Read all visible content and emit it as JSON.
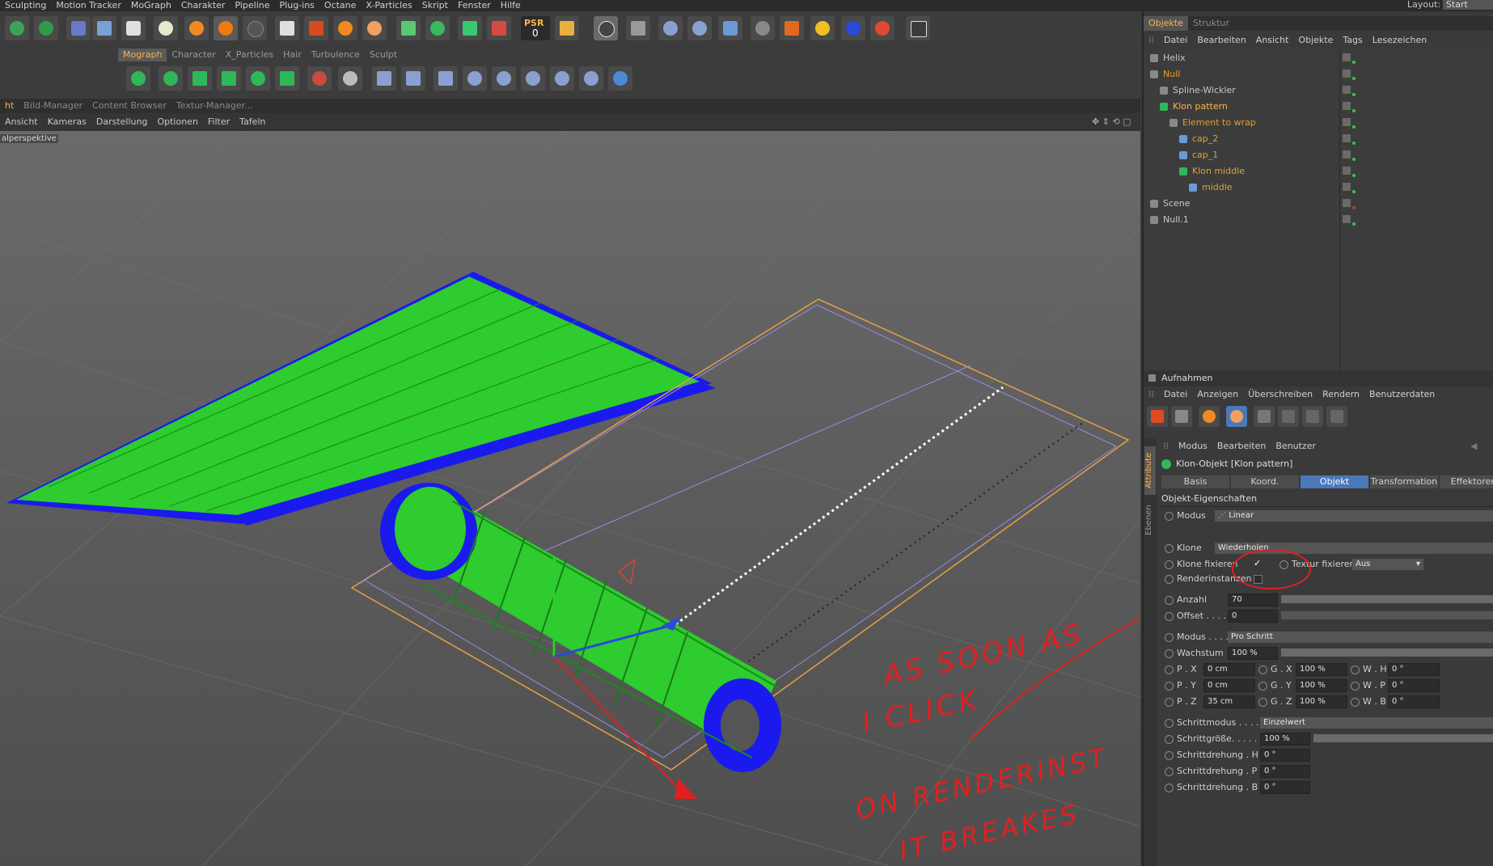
{
  "menubar": [
    "Sculpting",
    "Motion Tracker",
    "MoGraph",
    "Charakter",
    "Pipeline",
    "Plug-ins",
    "Octane",
    "X-Particles",
    "Skript",
    "Fenster",
    "Hilfe"
  ],
  "layout": {
    "label": "Layout:",
    "value": "Start (Benu"
  },
  "toolbar1": {
    "psr_label": "PSR",
    "psr_value": "0"
  },
  "subtabs": [
    "Mograph",
    "Character",
    "X_Particles",
    "Hair",
    "Turbulence",
    "Sculpt"
  ],
  "viewport_tabs": [
    "ht",
    "Bild-Manager",
    "Content Browser",
    "Textur-Manager..."
  ],
  "viewport_menu": [
    "Ansicht",
    "Kameras",
    "Darstellung",
    "Optionen",
    "Filter",
    "Tafeln"
  ],
  "viewport_label": "alperspektive",
  "objects_panel": {
    "tabs": [
      "Objekte",
      "Struktur"
    ],
    "menu": [
      "Datei",
      "Bearbeiten",
      "Ansicht",
      "Objekte",
      "Tags",
      "Lesezeichen"
    ],
    "items": [
      {
        "name": "Helix",
        "indent": 0,
        "color": "#c8c8c8"
      },
      {
        "name": "Null",
        "indent": 0,
        "color": "#e0a030"
      },
      {
        "name": "Spline-Wickler",
        "indent": 1,
        "color": "#c8c8c8"
      },
      {
        "name": "Klon pattern",
        "indent": 1,
        "color": "#ffb347"
      },
      {
        "name": "Element to wrap",
        "indent": 2,
        "color": "#e0a030"
      },
      {
        "name": "cap_2",
        "indent": 3,
        "color": "#e0a030"
      },
      {
        "name": "cap_1",
        "indent": 3,
        "color": "#e0a030"
      },
      {
        "name": "Klon middle",
        "indent": 3,
        "color": "#e0a030"
      },
      {
        "name": "middle",
        "indent": 4,
        "color": "#e0a030"
      },
      {
        "name": "Scene",
        "indent": 0,
        "color": "#c8c8c8"
      },
      {
        "name": "Null.1",
        "indent": 0,
        "color": "#c8c8c8"
      }
    ]
  },
  "takes_panel": {
    "title": "Aufnahmen",
    "menu": [
      "Datei",
      "Anzeigen",
      "Überschreiben",
      "Rendern",
      "Benutzerdaten"
    ]
  },
  "attributes": {
    "side_tabs": [
      "Attribute",
      "Ebenen"
    ],
    "menu": [
      "Modus",
      "Bearbeiten",
      "Benutzer"
    ],
    "object_title": "Klon-Objekt [Klon pattern]",
    "tabs": [
      "Basis",
      "Koord.",
      "Objekt",
      "Transformation",
      "Effektoren"
    ],
    "section": "Objekt-Eigenschaften",
    "modus_label": "Modus",
    "modus_value": "Linear",
    "klone_label": "Klone",
    "klone_value": "Wiederholen",
    "klone_fixieren_label": "Klone fixieren",
    "textur_fixieren_label": "Textur fixieren",
    "textur_fixieren_value": "Aus",
    "renderinstanzen_label": "Renderinstanzen",
    "anzahl_label": "Anzahl",
    "anzahl_value": "70",
    "offset_label": "Offset . . . .",
    "offset_value": "0",
    "modus2_label": "Modus . . . .",
    "modus2_value": "Pro Schritt",
    "wachstum_label": "Wachstum",
    "wachstum_value": "100 %",
    "px_label": "P . X",
    "px_value": "0 cm",
    "py_label": "P . Y",
    "py_value": "0 cm",
    "pz_label": "P . Z",
    "pz_value": "35 cm",
    "gx_label": "G . X",
    "gx_value": "100 %",
    "gy_label": "G . Y",
    "gy_value": "100 %",
    "gz_label": "G . Z",
    "gz_value": "100 %",
    "wh_label": "W . H",
    "wh_value": "0 °",
    "wp_label": "W . P",
    "wp_value": "0 °",
    "wb_label": "W . B",
    "wb_value": "0 °",
    "schrittmodus_label": "Schrittmodus . . . . .",
    "schrittmodus_value": "Einzelwert",
    "schrittgroesse_label": "Schrittgröße. . . . .",
    "schrittgroesse_value": "100 %",
    "sdh_label": "Schrittdrehung . H",
    "sdh_value": "0 °",
    "sdp_label": "Schrittdrehung . P",
    "sdp_value": "0 °",
    "sdb_label": "Schrittdrehung . B",
    "sdb_value": "0 °"
  },
  "annotation": {
    "line1": "AS SOON AS",
    "line2": "I CLICK",
    "line3": "ON RENDERINST",
    "line4": "IT BREAKES"
  },
  "colors": {
    "accent": "#ffb347",
    "clone_green": "#2ecc2e",
    "clone_blue": "#1a1aee",
    "annotation_red": "#e02020",
    "active_tab": "#4a78b8"
  }
}
